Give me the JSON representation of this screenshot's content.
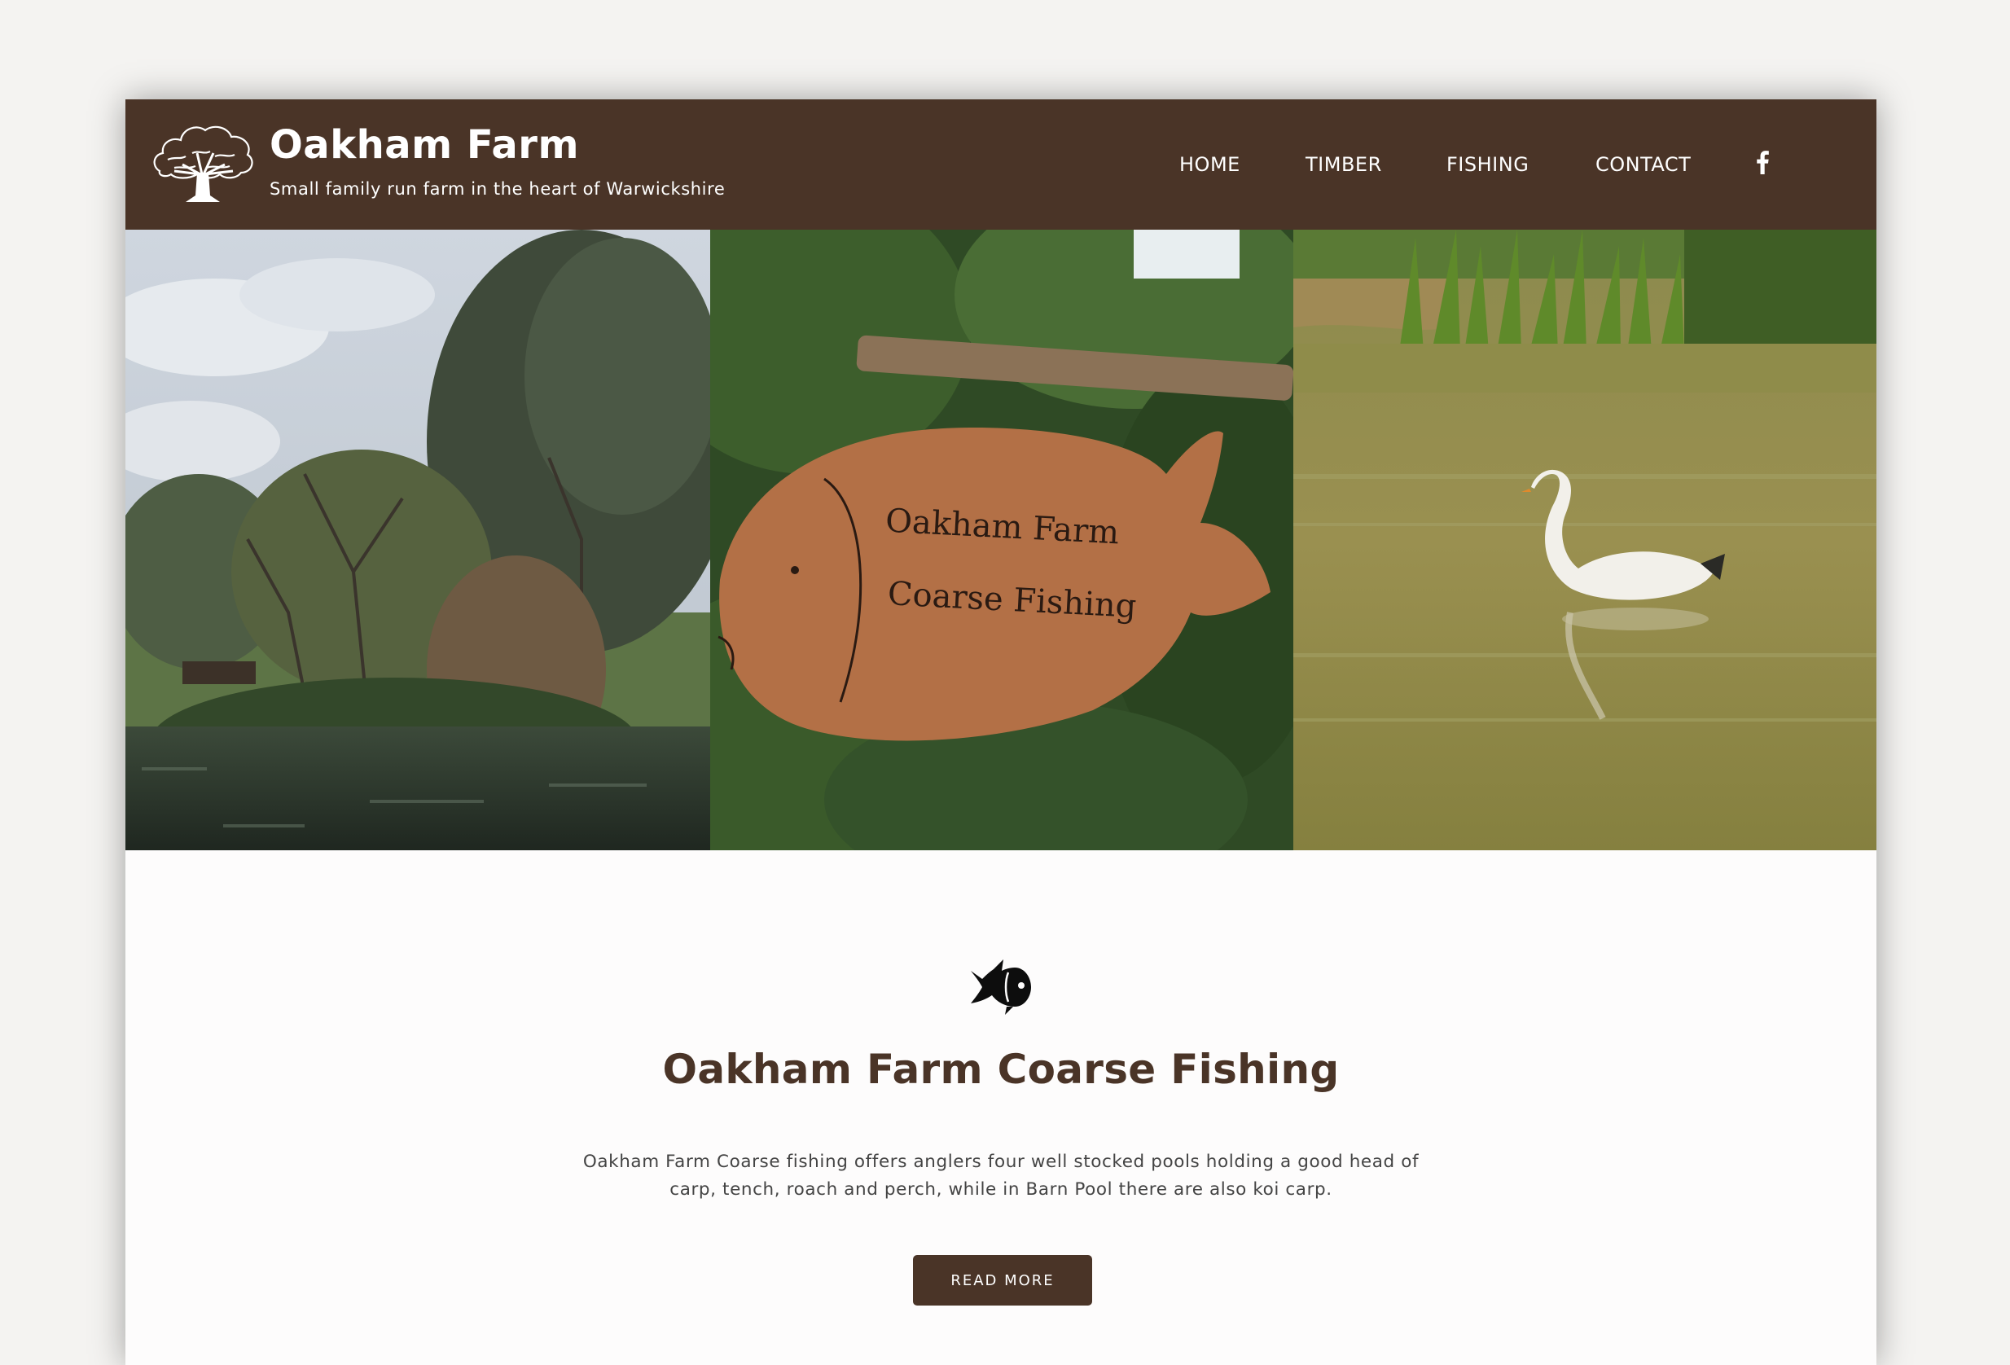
{
  "site": {
    "title": "Oakham Farm",
    "tagline": "Small family run farm in the heart of Warwickshire",
    "logo_icon": "oak-tree-icon"
  },
  "nav": {
    "items": [
      {
        "label": "HOME"
      },
      {
        "label": "TIMBER"
      },
      {
        "label": "FISHING"
      },
      {
        "label": "CONTACT"
      }
    ],
    "social_icon": "facebook-icon"
  },
  "hero": {
    "panels": [
      {
        "name": "pond-trees-photo"
      },
      {
        "name": "fish-sign-photo",
        "sign_line1": "Oakham Farm",
        "sign_line2": "Coarse Fishing"
      },
      {
        "name": "swan-pond-photo"
      }
    ]
  },
  "section": {
    "icon": "fish-icon",
    "heading": "Oakham Farm Coarse Fishing",
    "description": "Oakham Farm Coarse fishing offers anglers four well stocked pools holding a good head of carp, tench, roach and perch, while in Barn Pool there are also koi carp.",
    "button_label": "READ MORE"
  },
  "colors": {
    "brand_brown": "#4a3427",
    "background": "#f4f3f1",
    "white": "#ffffff"
  }
}
